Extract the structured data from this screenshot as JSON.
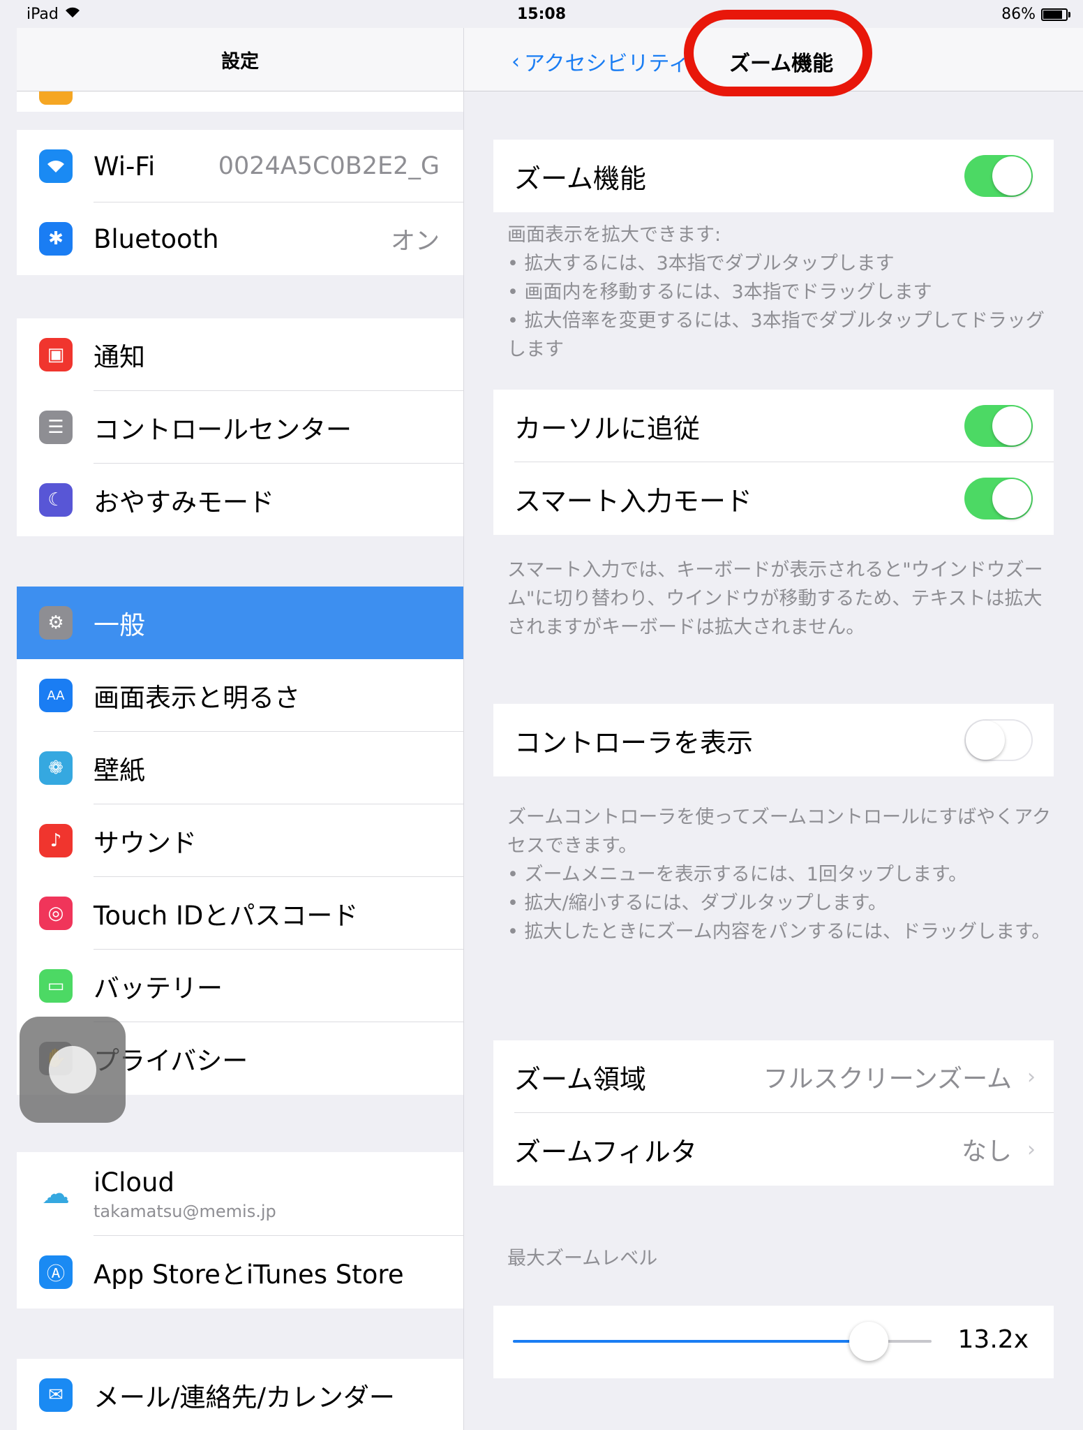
{
  "status_bar": {
    "device": "iPad",
    "time": "15:08",
    "battery": "86%"
  },
  "master": {
    "title": "設定",
    "items": [
      {
        "label": "Wi-Fi",
        "value": "0024A5C0B2E2_G",
        "color": "#1a8af3"
      },
      {
        "label": "Bluetooth",
        "value": "オン",
        "color": "#1a7df3"
      },
      {
        "label": "通知",
        "color": "#f0352e"
      },
      {
        "label": "コントロールセンター",
        "color": "#8e8e93"
      },
      {
        "label": "おやすみモード",
        "color": "#5856d6"
      },
      {
        "label": "一般",
        "color": "#8e8e93"
      },
      {
        "label": "画面表示と明るさ",
        "color": "#1a7df3"
      },
      {
        "label": "壁紙",
        "color": "#35a8e0"
      },
      {
        "label": "サウンド",
        "color": "#f0352e"
      },
      {
        "label": "Touch IDとパスコード",
        "color": "#f0355a"
      },
      {
        "label": "バッテリー",
        "color": "#4cd964"
      },
      {
        "label": "プライバシー",
        "color": "#8e8e93"
      },
      {
        "label": "iCloud",
        "sub": "takamatsu@memis.jp",
        "color": "#35a8e0"
      },
      {
        "label": "App StoreとiTunes Store",
        "color": "#1a8af3"
      },
      {
        "label": "メール/連絡先/カレンダー",
        "color": "#1a8af3"
      }
    ]
  },
  "detail": {
    "back": "アクセシビリティ",
    "title": "ズーム機能",
    "zoom": {
      "label": "ズーム機能",
      "on": true
    },
    "zoom_footer": [
      "画面表示を拡大できます:",
      "• 拡大するには、3本指でダブルタップします",
      "• 画面内を移動するには、3本指でドラッグします",
      "• 拡大倍率を変更するには、3本指でダブルタップしてドラッグします"
    ],
    "follow_cursor": {
      "label": "カーソルに追従",
      "on": true
    },
    "smart_typing": {
      "label": "スマート入力モード",
      "on": true
    },
    "smart_footer": "スマート入力では、キーボードが表示されると\"ウインドウズーム\"に切り替わり、ウインドウが移動するため、テキストは拡大されますがキーボードは拡大されません。",
    "show_controller": {
      "label": "コントローラを表示",
      "on": false
    },
    "controller_footer": [
      "ズームコントローラを使ってズームコントロールにすばやくアクセスできます。",
      "• ズームメニューを表示するには、1回タップします。",
      "• 拡大/縮小するには、ダブルタップします。",
      "• 拡大したときにズーム内容をパンするには、ドラッグします。"
    ],
    "zoom_region": {
      "label": "ズーム領域",
      "value": "フルスクリーンズーム"
    },
    "zoom_filter": {
      "label": "ズームフィルタ",
      "value": "なし"
    },
    "max_zoom": {
      "header": "最大ズームレベル",
      "value": "13.2x",
      "fraction": 0.85
    }
  }
}
